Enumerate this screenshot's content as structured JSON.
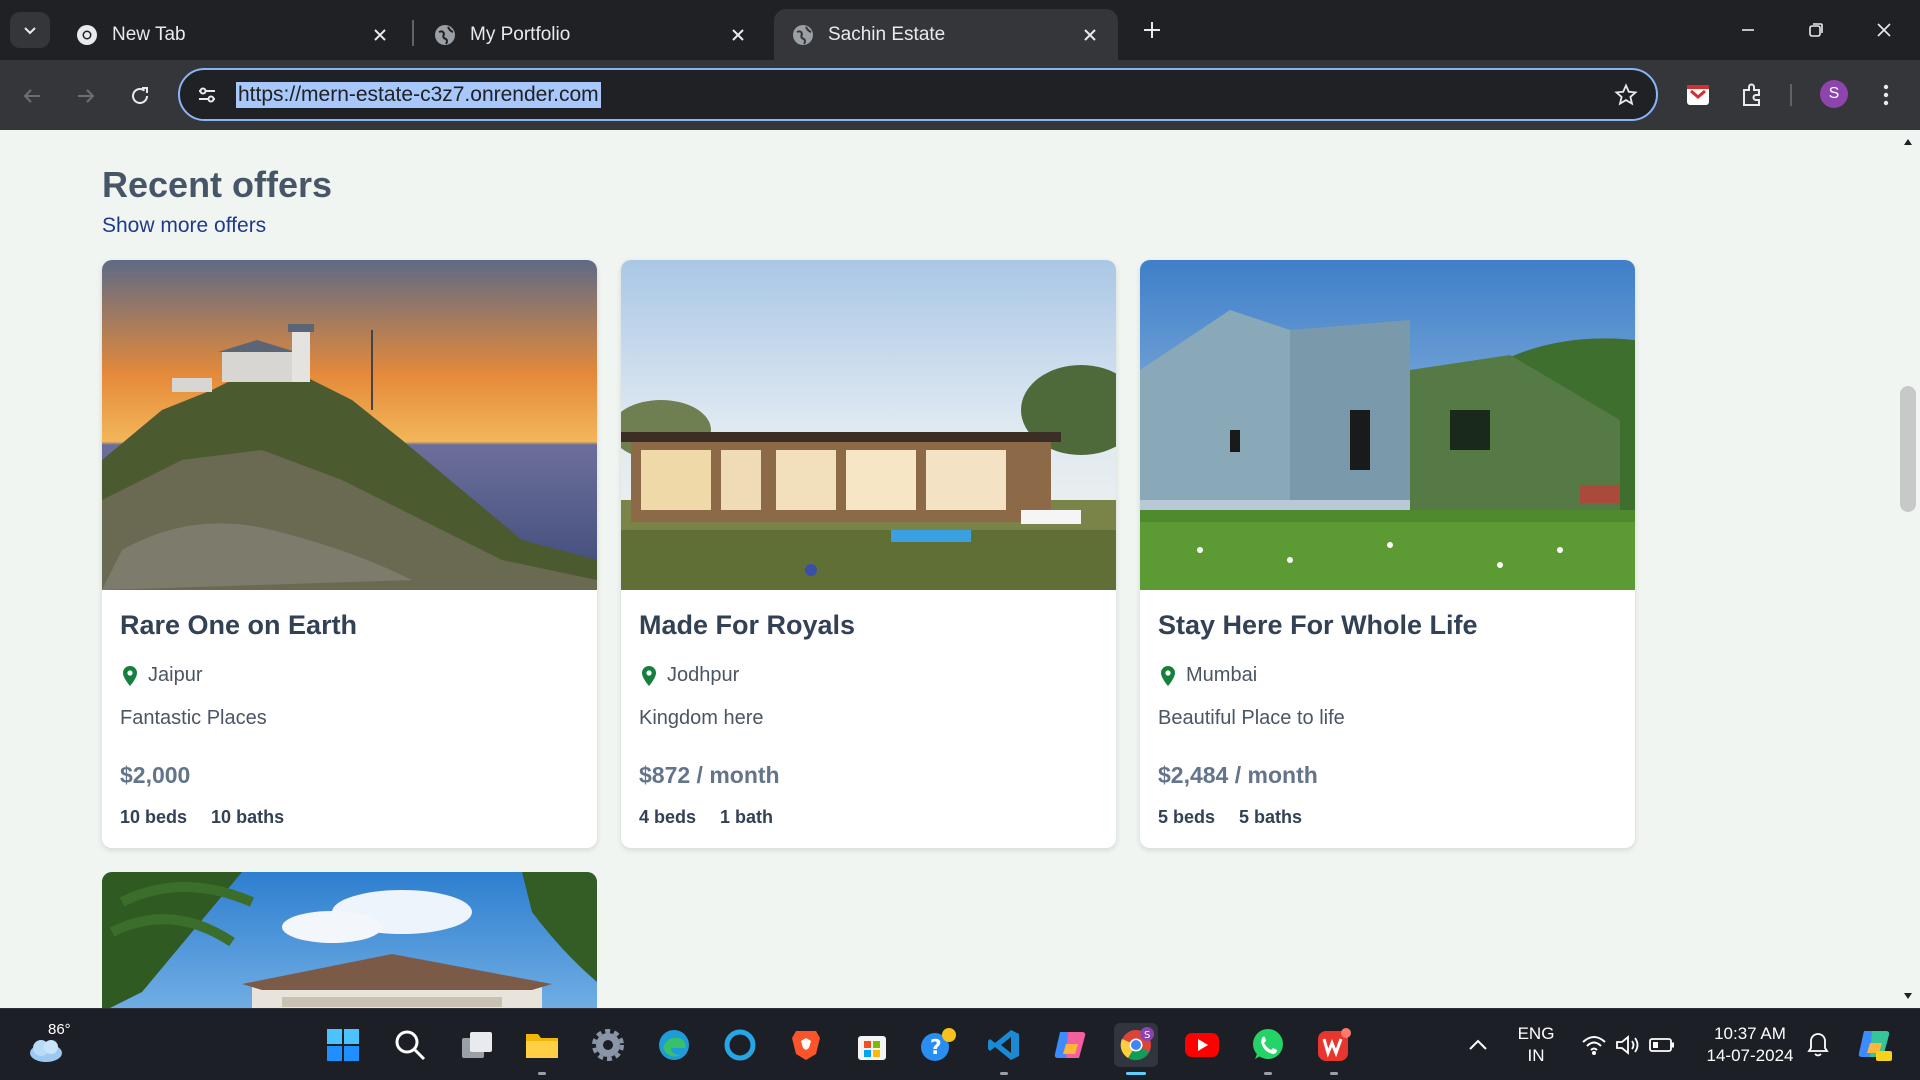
{
  "browser": {
    "tabs": [
      {
        "title": "New Tab",
        "icon": "chrome-icon"
      },
      {
        "title": "My Portfolio",
        "icon": "globe-icon"
      },
      {
        "title": "Sachin Estate",
        "icon": "globe-icon",
        "active": true
      }
    ],
    "url": "https://mern-estate-c3z7.onrender.com",
    "profile_initial": "S",
    "accent": "#8ab4f8"
  },
  "page": {
    "heading": "Recent offers",
    "more_link": "Show more offers",
    "listings": [
      {
        "title": "Rare One on Earth",
        "location": "Jaipur",
        "description": "Fantastic Places",
        "price": "$2,000",
        "beds": "10 beds",
        "baths": "10 baths"
      },
      {
        "title": "Made For Royals",
        "location": "Jodhpur",
        "description": "Kingdom here",
        "price": "$872 / month",
        "beds": "4 beds",
        "baths": "1 bath"
      },
      {
        "title": "Stay Here For Whole Life",
        "location": "Mumbai",
        "description": "Beautiful Place to life",
        "price": "$2,484 / month",
        "beds": "5 beds",
        "baths": "5 baths"
      }
    ],
    "pin_color": "#15803d"
  },
  "taskbar": {
    "weather_temp": "86°",
    "language": "ENG",
    "region": "IN",
    "time": "10:37 AM",
    "date": "14-07-2024",
    "apps": [
      "start-icon",
      "search-icon",
      "task-view-icon",
      "file-explorer-icon",
      "settings-icon",
      "edge-icon",
      "cortana-icon",
      "brave-icon",
      "microsoft-store-icon",
      "get-help-icon",
      "vscode-icon",
      "copilot-icon",
      "chrome-icon",
      "youtube-icon",
      "whatsapp-icon",
      "wps-office-icon"
    ]
  }
}
